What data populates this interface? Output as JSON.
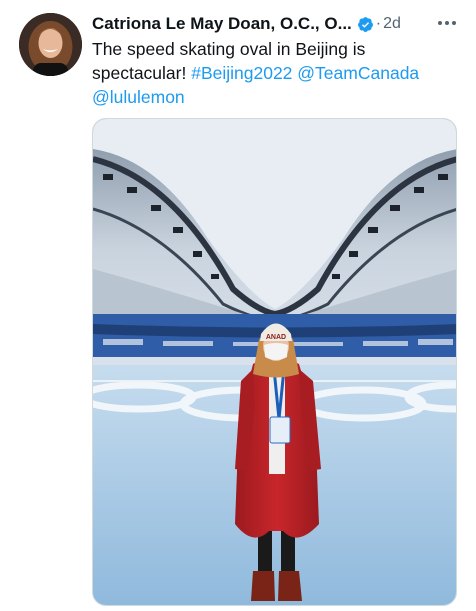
{
  "tweet": {
    "author_name": "Catriona Le May Doan, O.C., O...",
    "separator": "·",
    "timestamp": "2d",
    "text_line1": "The speed skating oval in Beijing is",
    "text_line2_plain": "spectacular! ",
    "hashtag": "#Beijing2022",
    "mention1": "@TeamCanada",
    "mention2": "@lululemon",
    "hat_text": "ANAD",
    "icons": {
      "avatar": "avatar-photo",
      "verified": "verified-badge-icon",
      "more": "more-options-icon"
    },
    "colors": {
      "link": "#1d9bf0",
      "secondary_text": "#536471",
      "verified": "#1d9bf0"
    }
  }
}
